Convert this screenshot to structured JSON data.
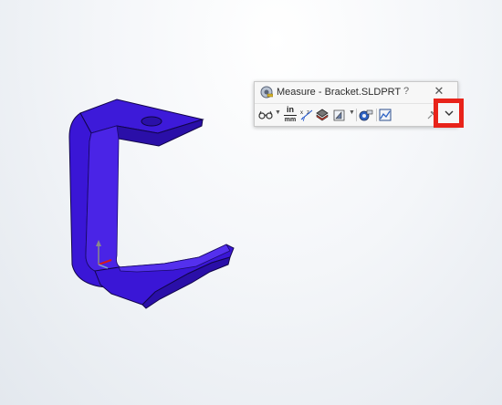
{
  "dialog": {
    "title": "Measure - Bracket.SLDPRT",
    "help_label": "?",
    "close_label": "✕",
    "toolbar": {
      "arc_circle_icon": "glasses-icon",
      "units_top": "in",
      "units_bottom": "mm",
      "xyz_icon": "xyz-icon",
      "projection_icon": "layers-icon",
      "show_xyz_icon": "plane-icon",
      "point_icon": "point-to-point-icon",
      "history_icon": "history-icon",
      "pin_icon": "pin-icon",
      "expand_icon": "chevron-down-icon",
      "expand_glyph": "⌄"
    }
  },
  "highlight_color": "#e8231a",
  "part_color": "#3a16d6",
  "part_name": "Bracket"
}
